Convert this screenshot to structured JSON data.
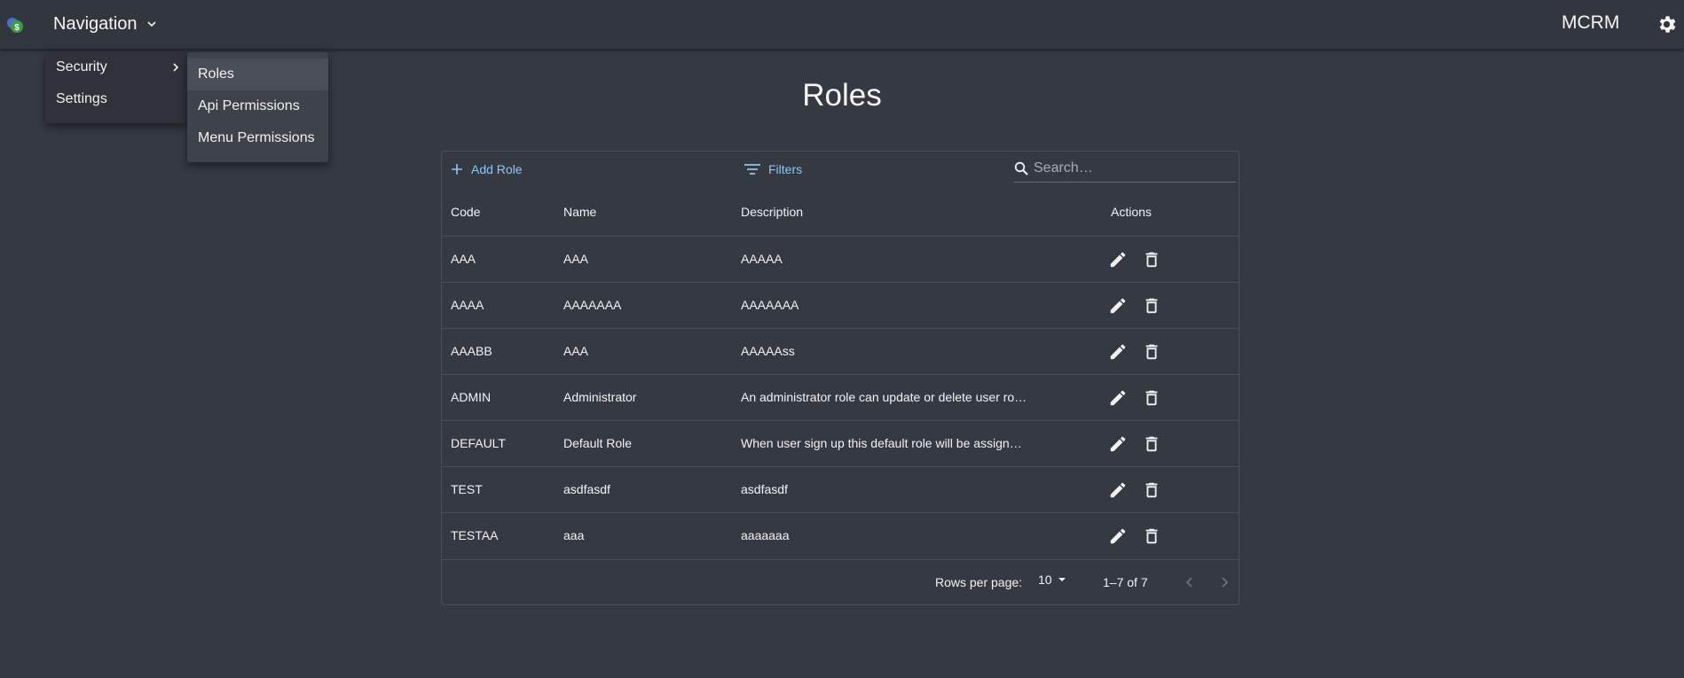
{
  "app": {
    "nav_label": "Navigation",
    "brand": "MCRM"
  },
  "menu": {
    "items": [
      {
        "label": "Security",
        "has_submenu": true
      },
      {
        "label": "Settings",
        "has_submenu": false
      }
    ],
    "submenu": [
      {
        "label": "Roles",
        "active": true
      },
      {
        "label": "Api Permissions",
        "active": false
      },
      {
        "label": "Menu Permissions",
        "active": false
      }
    ]
  },
  "page": {
    "title": "Roles"
  },
  "toolbar": {
    "add_label": "Add Role",
    "filters_label": "Filters",
    "search_placeholder": "Search…"
  },
  "table": {
    "columns": [
      "Code",
      "Name",
      "Description",
      "Actions"
    ],
    "rows": [
      {
        "code": "AAA",
        "name": "AAA",
        "description": "AAAAA"
      },
      {
        "code": "AAAA",
        "name": "AAAAAAA",
        "description": "AAAAAAA"
      },
      {
        "code": "AAABB",
        "name": "AAA",
        "description": "AAAAAss"
      },
      {
        "code": "ADMIN",
        "name": "Administrator",
        "description": "An administrator role can update or delete user ro…"
      },
      {
        "code": "DEFAULT",
        "name": "Default Role",
        "description": "When user sign up this default role will be assign…"
      },
      {
        "code": "TEST",
        "name": "asdfasdf",
        "description": "asdfasdf"
      },
      {
        "code": "TESTAA",
        "name": "aaa",
        "description": "aaaaaaa"
      }
    ]
  },
  "pagination": {
    "rows_per_page_label": "Rows per page:",
    "rows_per_page": "10",
    "range": "1–7 of 7"
  },
  "colors": {
    "background": "#353a42",
    "appbar": "#32373e",
    "accent": "#8ec6f5"
  }
}
